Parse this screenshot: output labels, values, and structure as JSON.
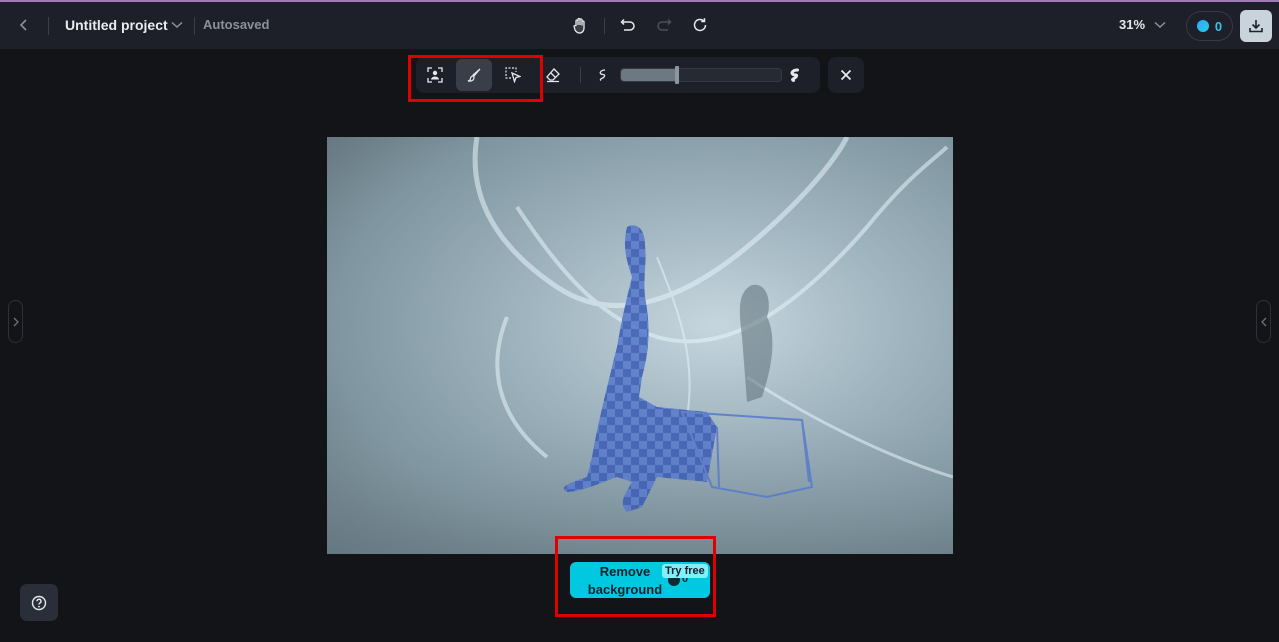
{
  "header": {
    "back_label": "Back",
    "project_title": "Untitled project",
    "save_status": "Autosaved",
    "zoom_level": "31%",
    "credits": "0",
    "icons": {
      "back": "chevron-left-icon",
      "title_dropdown": "chevron-down-icon",
      "hand": "hand-pan-icon",
      "undo": "undo-icon",
      "redo": "redo-icon",
      "refresh": "refresh-icon",
      "zoom_dropdown": "chevron-down-icon",
      "credit": "credit-coin-icon",
      "download": "download-icon"
    },
    "redo_enabled": false
  },
  "toolbar": {
    "tools": [
      {
        "name": "subject-select",
        "icon": "person-select-icon",
        "active": false
      },
      {
        "name": "brush",
        "icon": "brush-icon",
        "active": true
      },
      {
        "name": "area-select",
        "icon": "selection-cursor-icon",
        "active": false
      },
      {
        "name": "eraser",
        "icon": "eraser-icon",
        "active": false
      }
    ],
    "brush_size": {
      "min_icon": "thin-stroke-icon",
      "max_icon": "thick-stroke-icon",
      "value_percent": 35
    },
    "close_icon": "close-icon"
  },
  "canvas": {
    "description": "Woman in long dress leaning on a metal chair, light-painting background; subject masked with blue checker overlay",
    "mask_color": "#4a6cc8"
  },
  "actions": {
    "remove_background_label": "Remove background",
    "try_free_badge": "Try free",
    "cost": "0"
  },
  "panels": {
    "left_toggle": "chevron-right-icon",
    "right_toggle": "chevron-left-icon"
  },
  "help": {
    "icon": "help-circle-icon"
  },
  "colors": {
    "accent": "#00c8e0",
    "highlight_box": "#e00000",
    "header_bg": "#1d2029",
    "page_bg": "#121418"
  }
}
